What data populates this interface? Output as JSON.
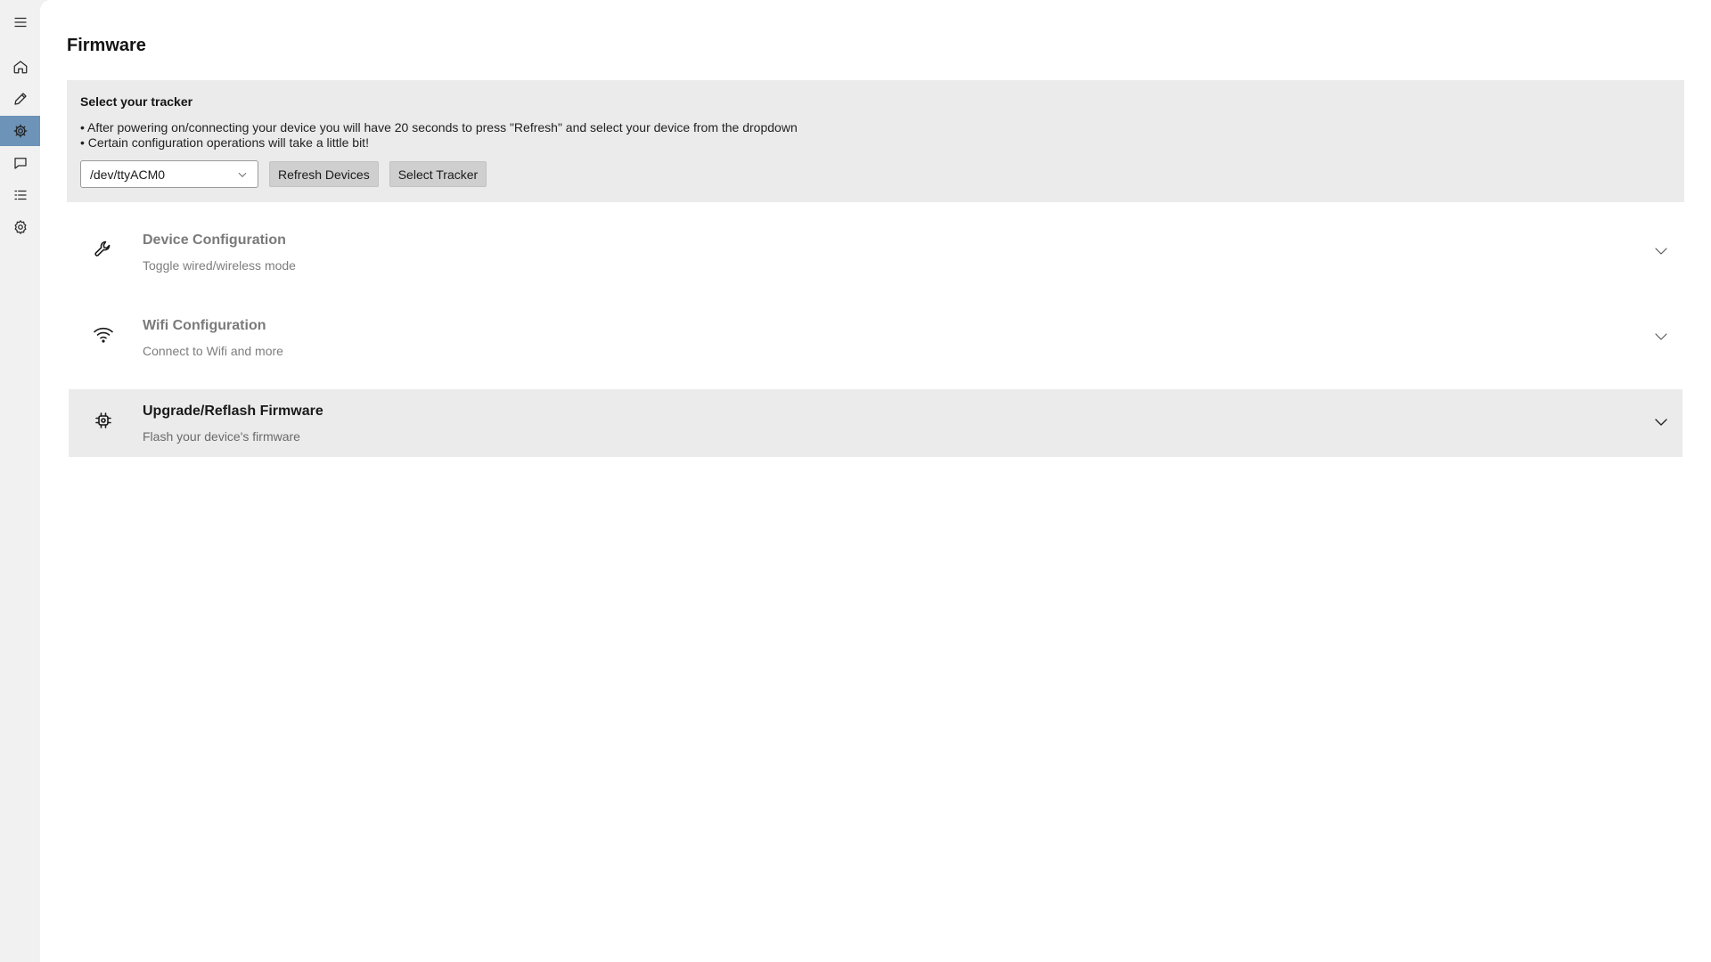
{
  "sidebar": {
    "items": [
      {
        "name": "menu",
        "icon": "menu-icon"
      },
      {
        "name": "home",
        "icon": "home-icon"
      },
      {
        "name": "edit",
        "icon": "pencil-icon"
      },
      {
        "name": "firmware",
        "icon": "chip-icon",
        "active": true
      },
      {
        "name": "chat",
        "icon": "chat-icon"
      },
      {
        "name": "list",
        "icon": "list-icon"
      },
      {
        "name": "settings",
        "icon": "gear-icon"
      }
    ],
    "active_color": "#6d93b8"
  },
  "page": {
    "title": "Firmware"
  },
  "tracker": {
    "heading": "Select your tracker",
    "note_1": "• After powering on/connecting your device you will have 20 seconds to press \"Refresh\" and select your device from the dropdown",
    "note_2": "• Certain configuration operations will take a little bit!",
    "selected_device": "/dev/ttyACM0",
    "refresh_label": "Refresh Devices",
    "select_label": "Select Tracker"
  },
  "sections": [
    {
      "title": "Device Configuration",
      "subtitle": "Toggle wired/wireless mode",
      "icon": "wrench-icon",
      "expanded": false
    },
    {
      "title": "Wifi Configuration",
      "subtitle": "Connect to Wifi and more",
      "icon": "wifi-icon",
      "expanded": false
    },
    {
      "title": "Upgrade/Reflash Firmware",
      "subtitle": "Flash your device's firmware",
      "icon": "chip-icon",
      "expanded": false,
      "highlighted": true
    }
  ]
}
